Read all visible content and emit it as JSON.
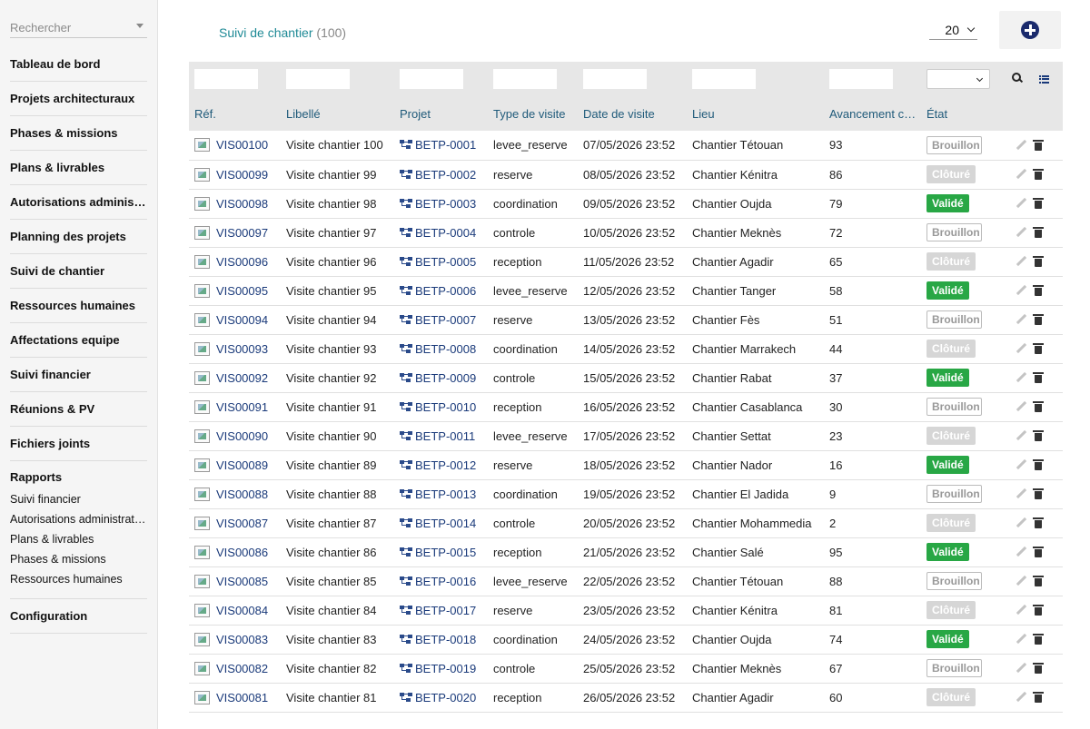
{
  "sidebar": {
    "search_placeholder": "Rechercher",
    "items": [
      "Tableau de bord",
      "Projets architecturaux",
      "Phases & missions",
      "Plans & livrables",
      "Autorisations administratives",
      "Planning des projets",
      "Suivi de chantier",
      "Ressources humaines",
      "Affectations equipe",
      "Suivi financier",
      "Réunions & PV",
      "Fichiers joints"
    ],
    "reports": {
      "title": "Rapports",
      "items": [
        "Suivi financier",
        "Autorisations administratives",
        "Plans & livrables",
        "Phases & missions",
        "Ressources humaines"
      ]
    },
    "config": "Configuration"
  },
  "header": {
    "title": "Suivi de chantier",
    "count": "(100)",
    "per_page": "20"
  },
  "table": {
    "columns": [
      "Réf.",
      "Libellé",
      "Projet",
      "Type de visite",
      "Date de visite",
      "Lieu",
      "Avancement constaté",
      "État"
    ],
    "status_labels": {
      "brouillon": "Brouillon",
      "cloture": "Clôturé",
      "valide": "Validé"
    },
    "rows": [
      {
        "ref": "VIS00100",
        "libelle": "Visite chantier 100",
        "projet": "BETP-0001",
        "type": "levee_reserve",
        "date": "07/05/2026 23:52",
        "lieu": "Chantier Tétouan",
        "avancement": "93",
        "etat": "Brouillon",
        "etat_class": "brouillon"
      },
      {
        "ref": "VIS00099",
        "libelle": "Visite chantier 99",
        "projet": "BETP-0002",
        "type": "reserve",
        "date": "08/05/2026 23:52",
        "lieu": "Chantier Kénitra",
        "avancement": "86",
        "etat": "Clôturé",
        "etat_class": "cloture"
      },
      {
        "ref": "VIS00098",
        "libelle": "Visite chantier 98",
        "projet": "BETP-0003",
        "type": "coordination",
        "date": "09/05/2026 23:52",
        "lieu": "Chantier Oujda",
        "avancement": "79",
        "etat": "Validé",
        "etat_class": "valide"
      },
      {
        "ref": "VIS00097",
        "libelle": "Visite chantier 97",
        "projet": "BETP-0004",
        "type": "controle",
        "date": "10/05/2026 23:52",
        "lieu": "Chantier Meknès",
        "avancement": "72",
        "etat": "Brouillon",
        "etat_class": "brouillon"
      },
      {
        "ref": "VIS00096",
        "libelle": "Visite chantier 96",
        "projet": "BETP-0005",
        "type": "reception",
        "date": "11/05/2026 23:52",
        "lieu": "Chantier Agadir",
        "avancement": "65",
        "etat": "Clôturé",
        "etat_class": "cloture"
      },
      {
        "ref": "VIS00095",
        "libelle": "Visite chantier 95",
        "projet": "BETP-0006",
        "type": "levee_reserve",
        "date": "12/05/2026 23:52",
        "lieu": "Chantier Tanger",
        "avancement": "58",
        "etat": "Validé",
        "etat_class": "valide"
      },
      {
        "ref": "VIS00094",
        "libelle": "Visite chantier 94",
        "projet": "BETP-0007",
        "type": "reserve",
        "date": "13/05/2026 23:52",
        "lieu": "Chantier Fès",
        "avancement": "51",
        "etat": "Brouillon",
        "etat_class": "brouillon"
      },
      {
        "ref": "VIS00093",
        "libelle": "Visite chantier 93",
        "projet": "BETP-0008",
        "type": "coordination",
        "date": "14/05/2026 23:52",
        "lieu": "Chantier Marrakech",
        "avancement": "44",
        "etat": "Clôturé",
        "etat_class": "cloture"
      },
      {
        "ref": "VIS00092",
        "libelle": "Visite chantier 92",
        "projet": "BETP-0009",
        "type": "controle",
        "date": "15/05/2026 23:52",
        "lieu": "Chantier Rabat",
        "avancement": "37",
        "etat": "Validé",
        "etat_class": "valide"
      },
      {
        "ref": "VIS00091",
        "libelle": "Visite chantier 91",
        "projet": "BETP-0010",
        "type": "reception",
        "date": "16/05/2026 23:52",
        "lieu": "Chantier Casablanca",
        "avancement": "30",
        "etat": "Brouillon",
        "etat_class": "brouillon"
      },
      {
        "ref": "VIS00090",
        "libelle": "Visite chantier 90",
        "projet": "BETP-0011",
        "type": "levee_reserve",
        "date": "17/05/2026 23:52",
        "lieu": "Chantier Settat",
        "avancement": "23",
        "etat": "Clôturé",
        "etat_class": "cloture"
      },
      {
        "ref": "VIS00089",
        "libelle": "Visite chantier 89",
        "projet": "BETP-0012",
        "type": "reserve",
        "date": "18/05/2026 23:52",
        "lieu": "Chantier Nador",
        "avancement": "16",
        "etat": "Validé",
        "etat_class": "valide"
      },
      {
        "ref": "VIS00088",
        "libelle": "Visite chantier 88",
        "projet": "BETP-0013",
        "type": "coordination",
        "date": "19/05/2026 23:52",
        "lieu": "Chantier El Jadida",
        "avancement": "9",
        "etat": "Brouillon",
        "etat_class": "brouillon"
      },
      {
        "ref": "VIS00087",
        "libelle": "Visite chantier 87",
        "projet": "BETP-0014",
        "type": "controle",
        "date": "20/05/2026 23:52",
        "lieu": "Chantier Mohammedia",
        "avancement": "2",
        "etat": "Clôturé",
        "etat_class": "cloture"
      },
      {
        "ref": "VIS00086",
        "libelle": "Visite chantier 86",
        "projet": "BETP-0015",
        "type": "reception",
        "date": "21/05/2026 23:52",
        "lieu": "Chantier Salé",
        "avancement": "95",
        "etat": "Validé",
        "etat_class": "valide"
      },
      {
        "ref": "VIS00085",
        "libelle": "Visite chantier 85",
        "projet": "BETP-0016",
        "type": "levee_reserve",
        "date": "22/05/2026 23:52",
        "lieu": "Chantier Tétouan",
        "avancement": "88",
        "etat": "Brouillon",
        "etat_class": "brouillon"
      },
      {
        "ref": "VIS00084",
        "libelle": "Visite chantier 84",
        "projet": "BETP-0017",
        "type": "reserve",
        "date": "23/05/2026 23:52",
        "lieu": "Chantier Kénitra",
        "avancement": "81",
        "etat": "Clôturé",
        "etat_class": "cloture"
      },
      {
        "ref": "VIS00083",
        "libelle": "Visite chantier 83",
        "projet": "BETP-0018",
        "type": "coordination",
        "date": "24/05/2026 23:52",
        "lieu": "Chantier Oujda",
        "avancement": "74",
        "etat": "Validé",
        "etat_class": "valide"
      },
      {
        "ref": "VIS00082",
        "libelle": "Visite chantier 82",
        "projet": "BETP-0019",
        "type": "controle",
        "date": "25/05/2026 23:52",
        "lieu": "Chantier Meknès",
        "avancement": "67",
        "etat": "Brouillon",
        "etat_class": "brouillon"
      },
      {
        "ref": "VIS00081",
        "libelle": "Visite chantier 81",
        "projet": "BETP-0020",
        "type": "reception",
        "date": "26/05/2026 23:52",
        "lieu": "Chantier Agadir",
        "avancement": "60",
        "etat": "Clôturé",
        "etat_class": "cloture"
      }
    ]
  }
}
